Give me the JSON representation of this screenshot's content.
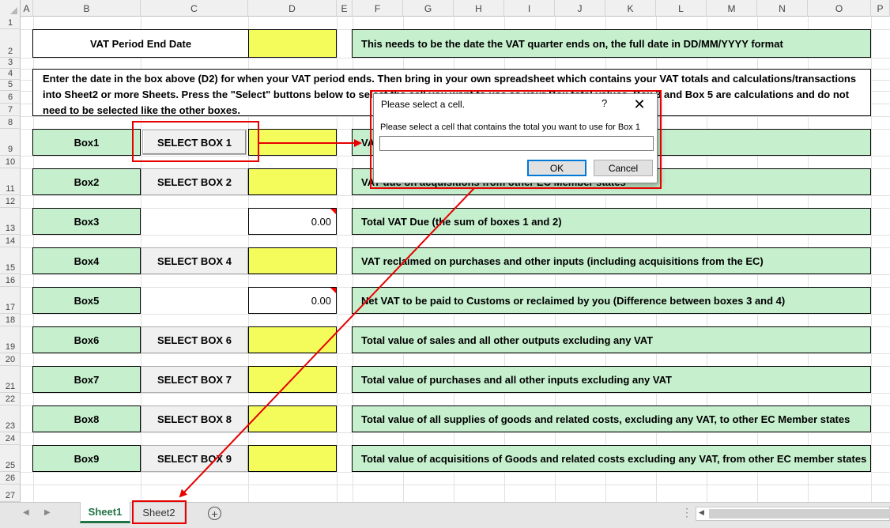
{
  "columns": [
    "A",
    "B",
    "C",
    "D",
    "E",
    "F",
    "G",
    "H",
    "I",
    "J",
    "K",
    "L",
    "M",
    "N",
    "O",
    "P"
  ],
  "rows": [
    "1",
    "2",
    "3",
    "4",
    "5",
    "6",
    "7",
    "8",
    "9",
    "10",
    "11",
    "12",
    "13",
    "14",
    "15",
    "16",
    "17",
    "18",
    "19",
    "20",
    "21",
    "22",
    "23",
    "24",
    "25",
    "26",
    "27"
  ],
  "period": {
    "label": "VAT Period End Date",
    "note": "This needs to be the date the VAT quarter ends on, the full date in DD/MM/YYYY format"
  },
  "instructions": "Enter the date in the box above (D2) for when your VAT period ends. Then bring in your own spreadsheet which contains your VAT totals and calculations/transactions into Sheet2 or more Sheets. Press the \"Select\" buttons below to select the cell you want to use as your Box total values. Box 3 and Box 5 are calculations and do not need to be selected like the other boxes.",
  "boxes": [
    {
      "label": "Box1",
      "button": "SELECT BOX 1",
      "value": "",
      "desc": "VAT due in this period on sales and other outputs"
    },
    {
      "label": "Box2",
      "button": "SELECT BOX 2",
      "value": "",
      "desc": "VAT due on acquisitions from other EC Member states"
    },
    {
      "label": "Box3",
      "button": "",
      "value": "0.00",
      "desc": "Total VAT Due (the sum of boxes 1 and 2)"
    },
    {
      "label": "Box4",
      "button": "SELECT BOX 4",
      "value": "",
      "desc": "VAT reclaimed on purchases and other inputs (including acquisitions from the EC)"
    },
    {
      "label": "Box5",
      "button": "",
      "value": "0.00",
      "desc": "Net VAT to be paid to Customs or reclaimed by you (Difference between boxes 3 and 4)"
    },
    {
      "label": "Box6",
      "button": "SELECT BOX 6",
      "value": "",
      "desc": "Total value of sales and all other outputs excluding any VAT"
    },
    {
      "label": "Box7",
      "button": "SELECT BOX 7",
      "value": "",
      "desc": "Total value of purchases and all other inputs excluding any VAT"
    },
    {
      "label": "Box8",
      "button": "SELECT BOX 8",
      "value": "",
      "desc": "Total value of all supplies of goods and related costs, excluding any VAT, to other EC Member states"
    },
    {
      "label": "Box9",
      "button": "SELECT BOX 9",
      "value": "",
      "desc": "Total value of acquisitions of Goods and related costs excluding any VAT, from other EC member states"
    }
  ],
  "dialog": {
    "title": "Please select a cell.",
    "help": "?",
    "close": "✕",
    "prompt": "Please select a cell that contains the total you want to use for Box 1",
    "input_value": "",
    "ok": "OK",
    "cancel": "Cancel"
  },
  "tabs": {
    "sheet1": "Sheet1",
    "sheet2": "Sheet2",
    "add": "+",
    "prev": "◀",
    "next": "▶"
  },
  "colors": {
    "green_cell": "#c6efce",
    "yellow_cell": "#f4fc5c",
    "annotation": "#e60000",
    "active_tab": "#217346"
  }
}
